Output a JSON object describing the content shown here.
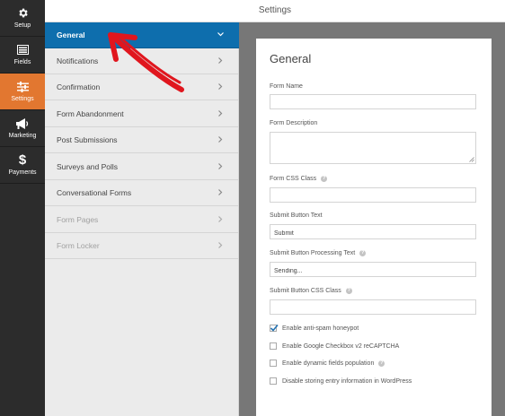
{
  "rail": {
    "items": [
      {
        "label": "Setup",
        "icon": "gear-icon"
      },
      {
        "label": "Fields",
        "icon": "fields-icon"
      },
      {
        "label": "Settings",
        "icon": "sliders-icon"
      },
      {
        "label": "Marketing",
        "icon": "megaphone-icon"
      },
      {
        "label": "Payments",
        "icon": "dollar-icon"
      }
    ],
    "active": "Settings",
    "accent": "#e27730"
  },
  "topbar": {
    "title": "Settings"
  },
  "subnav": {
    "items": [
      {
        "label": "General",
        "state": "active"
      },
      {
        "label": "Notifications",
        "state": "normal"
      },
      {
        "label": "Confirmation",
        "state": "normal"
      },
      {
        "label": "Form Abandonment",
        "state": "normal"
      },
      {
        "label": "Post Submissions",
        "state": "normal"
      },
      {
        "label": "Surveys and Polls",
        "state": "normal"
      },
      {
        "label": "Conversational Forms",
        "state": "normal"
      },
      {
        "label": "Form Pages",
        "state": "disabled"
      },
      {
        "label": "Form Locker",
        "state": "disabled"
      }
    ],
    "active_color": "#0e6ead"
  },
  "card": {
    "title": "General",
    "fields": {
      "form_name": {
        "label": "Form Name",
        "value": ""
      },
      "form_description": {
        "label": "Form Description",
        "value": ""
      },
      "form_css_class": {
        "label": "Form CSS Class",
        "value": "",
        "help": "?"
      },
      "submit_text": {
        "label": "Submit Button Text",
        "value": "Submit"
      },
      "submit_processing": {
        "label": "Submit Button Processing Text",
        "value": "Sending...",
        "help": "?"
      },
      "submit_css_class": {
        "label": "Submit Button CSS Class",
        "value": "",
        "help": "?"
      }
    },
    "checkboxes": [
      {
        "label": "Enable anti-spam honeypot",
        "checked": true
      },
      {
        "label": "Enable Google Checkbox v2 reCAPTCHA",
        "checked": false
      },
      {
        "label": "Enable dynamic fields population",
        "checked": false,
        "help": "?"
      },
      {
        "label": "Disable storing entry information in WordPress",
        "checked": false
      }
    ]
  },
  "annotation": {
    "color": "#e0161e",
    "shape": "arrow"
  }
}
